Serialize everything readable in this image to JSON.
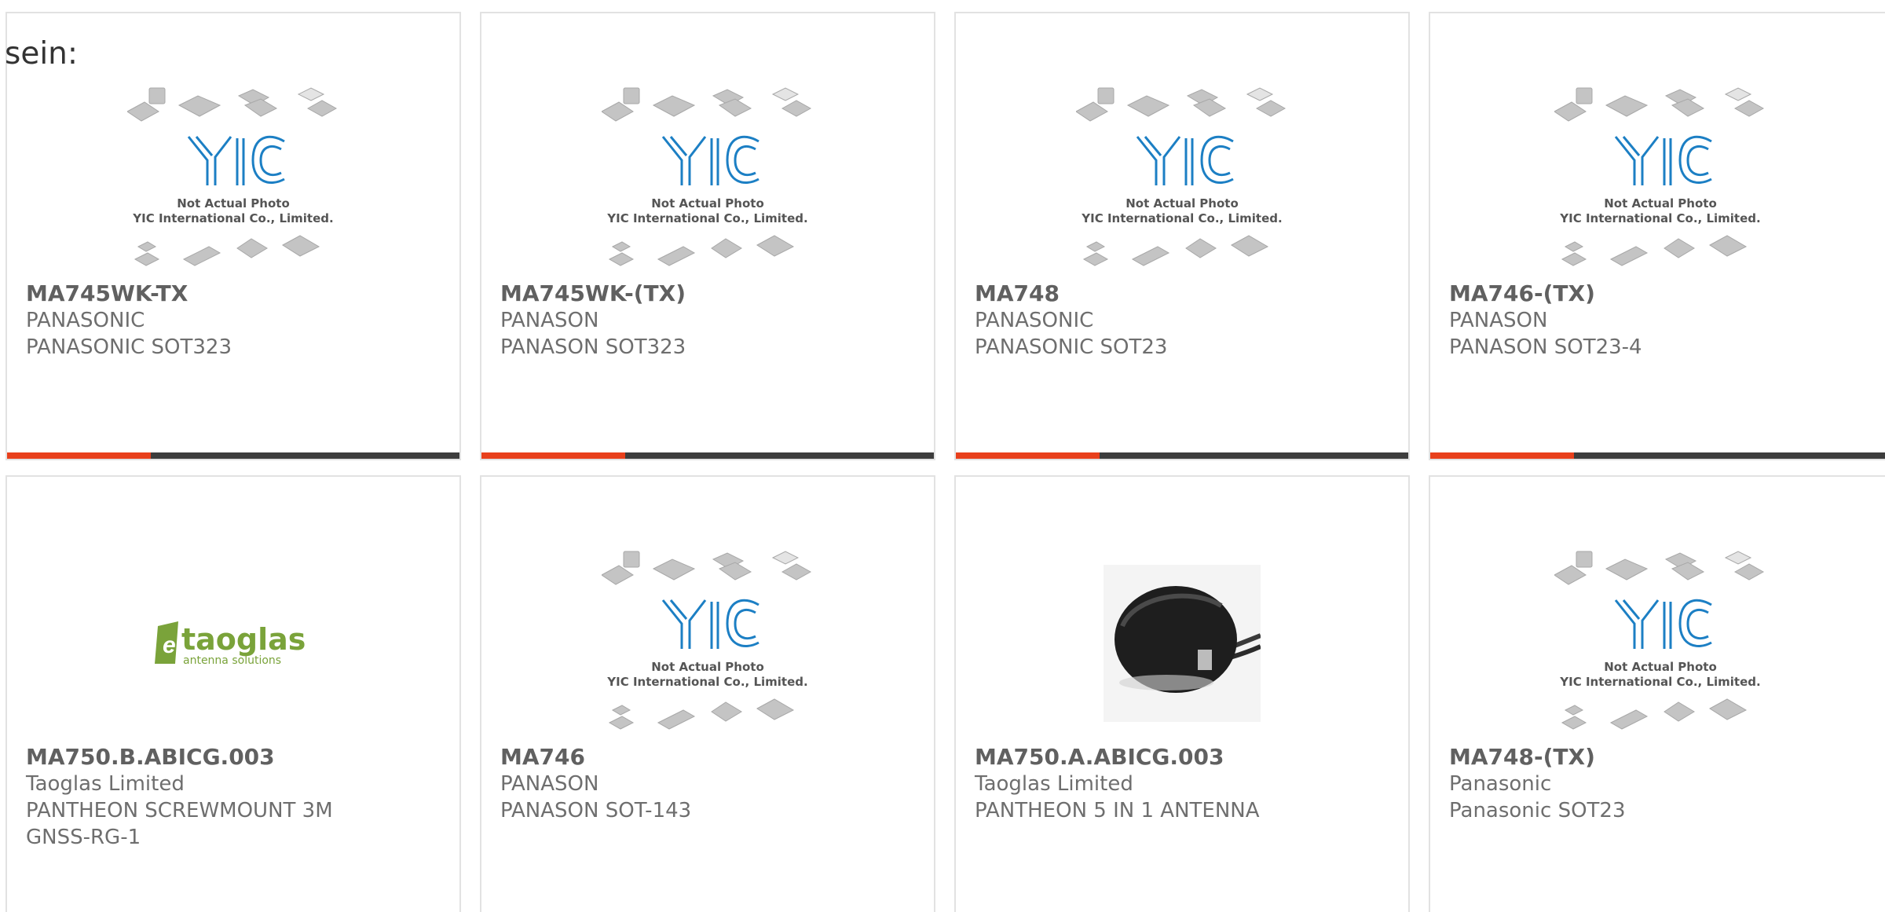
{
  "page": {
    "label": "sein:"
  },
  "placeholder_image": {
    "brand": "YIC",
    "line1": "Not Actual Photo",
    "line2": "YIC International Co., Limited."
  },
  "taoglas_logo": {
    "brand": "taoglas",
    "tagline": "antenna solutions"
  },
  "colors": {
    "accent": "#e8401c",
    "bar": "#3d3d3d",
    "logo_blue": "#1c7fc4",
    "taoglas_green": "#7aa33a"
  },
  "products": [
    {
      "part_number": "MA745WK-TX",
      "manufacturer": "PANASONIC",
      "description": "PANASONIC SOT323",
      "image": "yic-placeholder"
    },
    {
      "part_number": "MA745WK-(TX)",
      "manufacturer": "PANASON",
      "description": "PANASON SOT323",
      "image": "yic-placeholder"
    },
    {
      "part_number": "MA748",
      "manufacturer": "PANASONIC",
      "description": "PANASONIC SOT23",
      "image": "yic-placeholder"
    },
    {
      "part_number": "MA746-(TX)",
      "manufacturer": "PANASON",
      "description": "PANASON SOT23-4",
      "image": "yic-placeholder"
    },
    {
      "part_number": "MA750.B.ABICG.003",
      "manufacturer": "Taoglas Limited",
      "description": "PANTHEON SCREWMOUNT 3M GNSS-RG-1",
      "image": "taoglas-logo"
    },
    {
      "part_number": "MA746",
      "manufacturer": "PANASON",
      "description": "PANASON SOT-143",
      "image": "yic-placeholder"
    },
    {
      "part_number": "MA750.A.ABICG.003",
      "manufacturer": "Taoglas Limited",
      "description": "PANTHEON 5 IN 1 ANTENNA",
      "image": "antenna-photo"
    },
    {
      "part_number": "MA748-(TX)",
      "manufacturer": "Panasonic",
      "description": "Panasonic SOT23",
      "image": "yic-placeholder"
    }
  ]
}
